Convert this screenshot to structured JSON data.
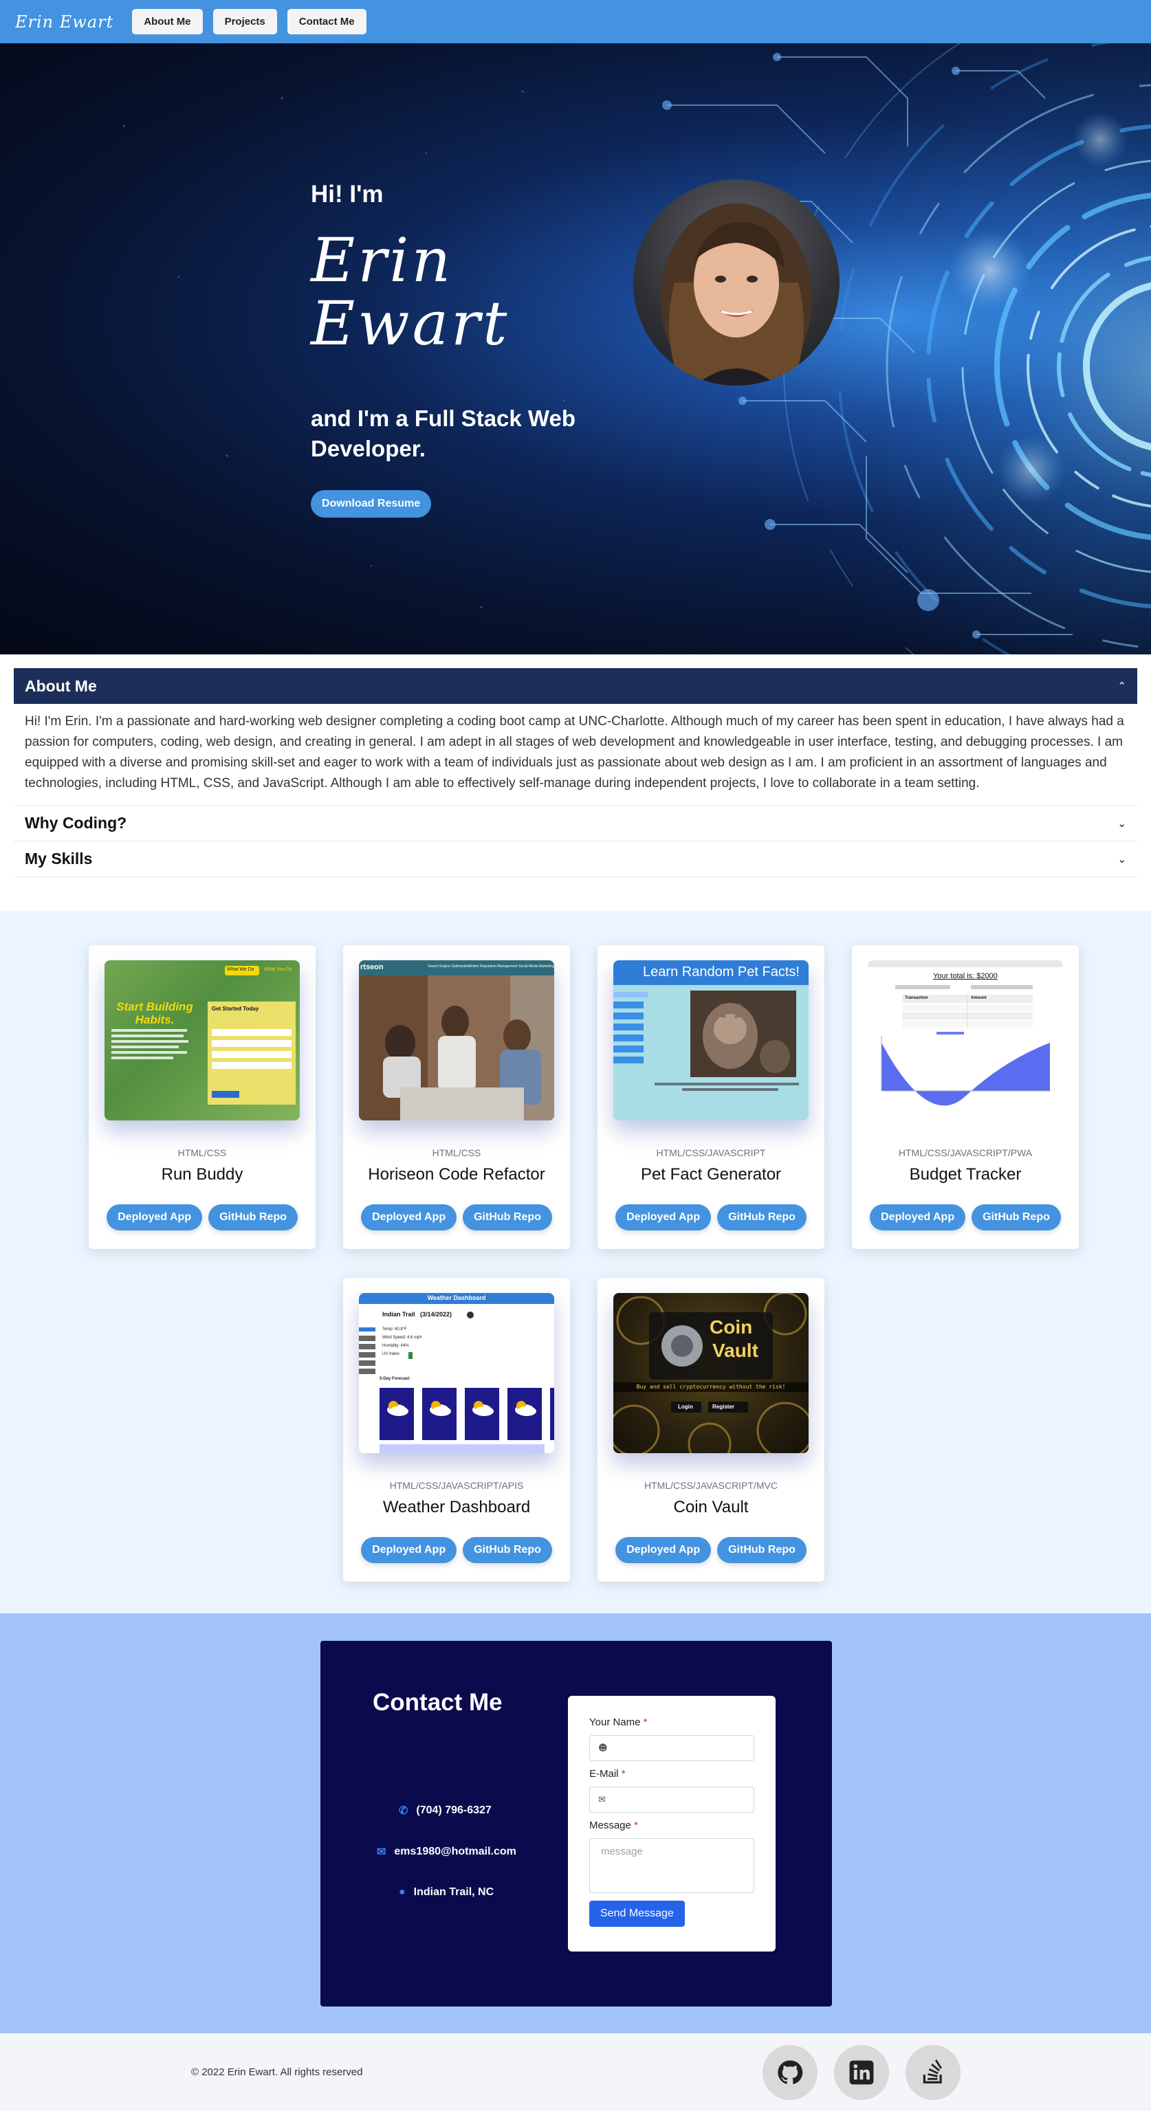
{
  "nav": {
    "logo": "Erin Ewart",
    "links": [
      "About Me",
      "Projects",
      "Contact Me"
    ]
  },
  "hero": {
    "greeting": "Hi! I'm",
    "first_name": "Erin",
    "last_name": "Ewart",
    "tagline": "and I'm a Full Stack Web Developer.",
    "resume_button": "Download Resume",
    "bg_color": "#07122c"
  },
  "accordion": [
    {
      "title": "About Me",
      "expanded": true,
      "body": "Hi! I'm Erin. I'm a passionate and hard-working web designer completing a coding boot camp at UNC-Charlotte. Although much of my career has been spent in education, I have always had a passion for computers, coding, web design, and creating in general. I am adept in all stages of web development and knowledgeable in user interface, testing, and debugging processes. I am equipped with a diverse and promising skill-set and eager to work with a team of individuals just as passionate about web design as I am. I am proficient in an assortment of languages and technologies, including HTML, CSS, and JavaScript. Although I am able to effectively self-manage during independent projects, I love to collaborate in a team setting."
    },
    {
      "title": "Why Coding?",
      "expanded": false
    },
    {
      "title": "My Skills",
      "expanded": false
    }
  ],
  "projects": [
    {
      "tech": "HTML/CSS",
      "title": "Run Buddy",
      "deployed": "Deployed App",
      "repo": "GitHub Repo",
      "thumb": {
        "heading": "Start Building Habits.",
        "form_title": "Get Started Today",
        "tabs": [
          "What We Do",
          "What You Do"
        ]
      }
    },
    {
      "tech": "HTML/CSS",
      "title": "Horiseon Code Refactor",
      "deployed": "Deployed App",
      "repo": "GitHub Repo",
      "thumb": {
        "brand": "rtseon",
        "menu": [
          "Search Engine Optimization",
          "Online Reputation Management",
          "Social Media Marketing"
        ]
      }
    },
    {
      "tech": "HTML/CSS/JAVASCRIPT",
      "title": "Pet Fact Generator",
      "deployed": "Deployed App",
      "repo": "GitHub Repo",
      "thumb": {
        "banner": "Learn Random Pet Facts!"
      }
    },
    {
      "tech": "HTML/CSS/JAVASCRIPT/PWA",
      "title": "Budget Tracker",
      "deployed": "Deployed App",
      "repo": "GitHub Repo",
      "thumb": {
        "total": "Your total is: $2000",
        "table_headers": [
          "Transaction",
          "Amount"
        ]
      }
    },
    {
      "tech": "HTML/CSS/JAVASCRIPT/APIS",
      "title": "Weather Dashboard",
      "deployed": "Deployed App",
      "repo": "GitHub Repo",
      "thumb": {
        "header": "Weather Dashboard",
        "city": "Indian Trail   (3/14/2022)",
        "stats": [
          "Temp: 60.8°F",
          "Wind Speed: 4.6 mph",
          "Humidity: 44%",
          "UV Index:"
        ],
        "forecast_title": "5-Day Forecast:"
      }
    },
    {
      "tech": "HTML/CSS/JAVASCRIPT/MVC",
      "title": "Coin Vault",
      "deployed": "Deployed App",
      "repo": "GitHub Repo",
      "thumb": {
        "name_line1": "Coin",
        "name_line2": "Vault",
        "tagline": "Buy and sell cryptocurrency without the risk!",
        "buttons": [
          "Login",
          "Register"
        ]
      }
    }
  ],
  "contact": {
    "title": "Contact Me",
    "phone": "(704) 796-6327",
    "email": "ems1980@hotmail.com",
    "location": "Indian Trail, NC",
    "form": {
      "name_label": "Your Name",
      "email_label": "E-Mail",
      "message_label": "Message",
      "required_mark": "*",
      "message_placeholder": "message",
      "send_button": "Send Message"
    }
  },
  "footer": {
    "copyright": "© 2022 Erin Ewart. All rights reserved",
    "social": [
      "github-icon",
      "linkedin-icon",
      "stackoverflow-icon"
    ]
  },
  "colors": {
    "nav": "#4393e0",
    "accent": "#4393e0",
    "accordion_header": "#1c2f5a",
    "projects_bg": "#eaf5ff",
    "contact_bg": "#a2c4fa",
    "contact_card": "#0a0a4d"
  }
}
